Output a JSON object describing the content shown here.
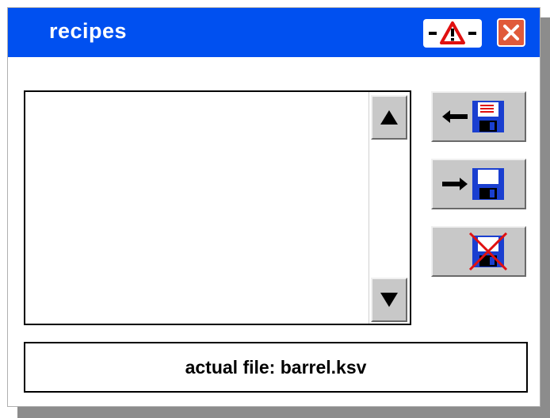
{
  "window": {
    "title": "recipes"
  },
  "titlebar": {
    "alarm_icon": "warning-triangle-icon",
    "close_icon": "close-icon"
  },
  "recipe_list": {
    "items": [],
    "scroll_up_icon": "arrow-up-icon",
    "scroll_down_icon": "arrow-down-icon"
  },
  "toolbar": {
    "load_icon": "load-from-disk-icon",
    "save_icon": "save-to-disk-icon",
    "delete_icon": "delete-file-icon"
  },
  "status": {
    "text": "actual file: barrel.ksv"
  },
  "colors": {
    "titlebar": "#0050f0",
    "button_face": "#c8c8c8",
    "close_button": "#e05a3a",
    "disk_blue": "#1a3fd0",
    "delete_cross": "#e01010"
  }
}
